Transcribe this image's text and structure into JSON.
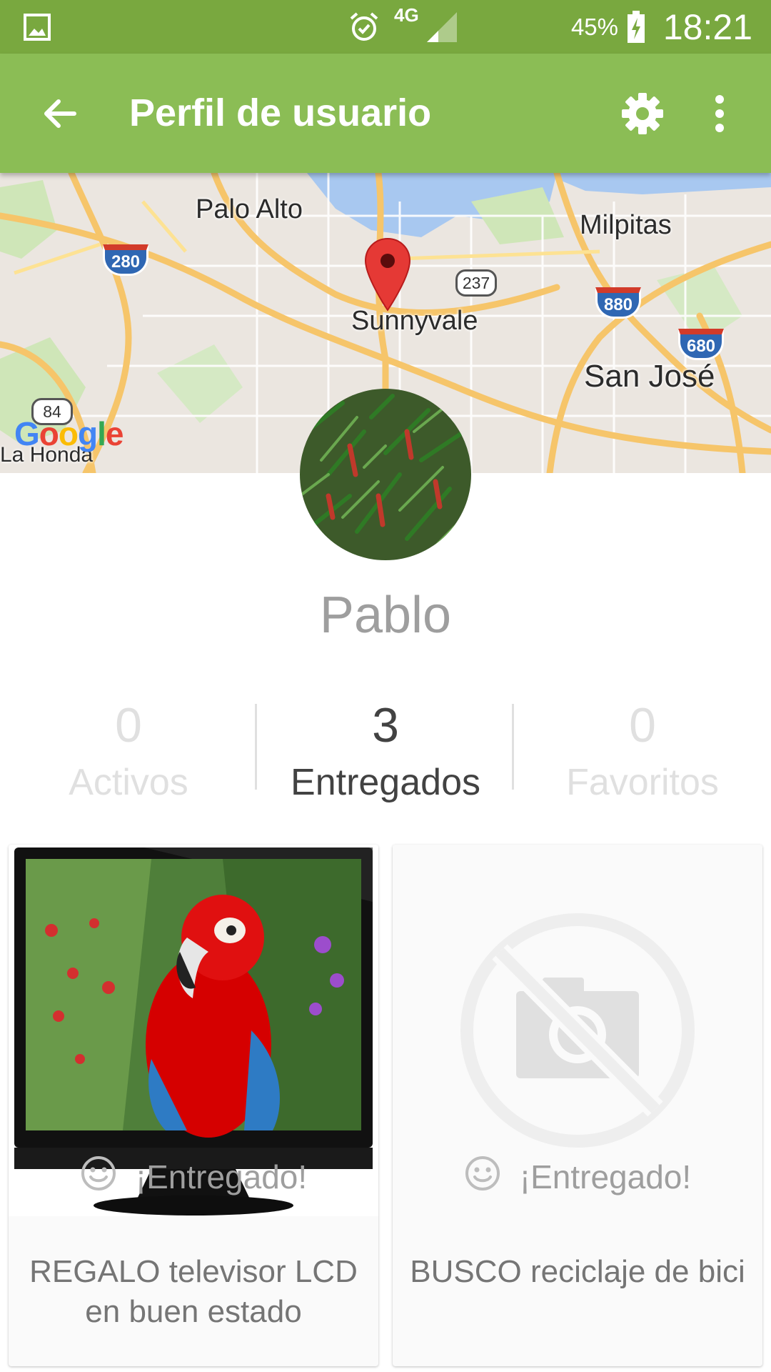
{
  "status_bar": {
    "network": "4G",
    "battery_percent": "45%",
    "time": "18:21"
  },
  "app_bar": {
    "title": "Perfil de usuario",
    "icons": [
      "back-arrow-icon",
      "gear-icon",
      "more-vert-icon"
    ]
  },
  "map": {
    "labels": {
      "palo_alto": "Palo Alto",
      "milpitas": "Milpitas",
      "sunnyvale": "Sunnyvale",
      "san_jose": "San José",
      "la_honda": "La Honda",
      "google": "Google"
    },
    "shields": {
      "i280": "280",
      "i880": "880",
      "i680": "680",
      "r237": "237",
      "r84": "84"
    }
  },
  "user": {
    "name": "Pablo"
  },
  "stats": [
    {
      "value": "0",
      "label": "Activos",
      "active": false
    },
    {
      "value": "3",
      "label": "Entregados",
      "active": true
    },
    {
      "value": "0",
      "label": "Favoritos",
      "active": false
    }
  ],
  "cards": [
    {
      "status": "¡Entregado!",
      "description": "REGALO televisor LCD en buen estado",
      "image": "tv-parrot-photo"
    },
    {
      "status": "¡Entregado!",
      "description": "BUSCO reciclaje de bici",
      "image": "no-photo-icon"
    }
  ],
  "colors": {
    "status_bar": "#79a83f",
    "app_bar": "#8bbd55",
    "active_text": "#424242",
    "inactive_text": "#e0e0e0"
  }
}
